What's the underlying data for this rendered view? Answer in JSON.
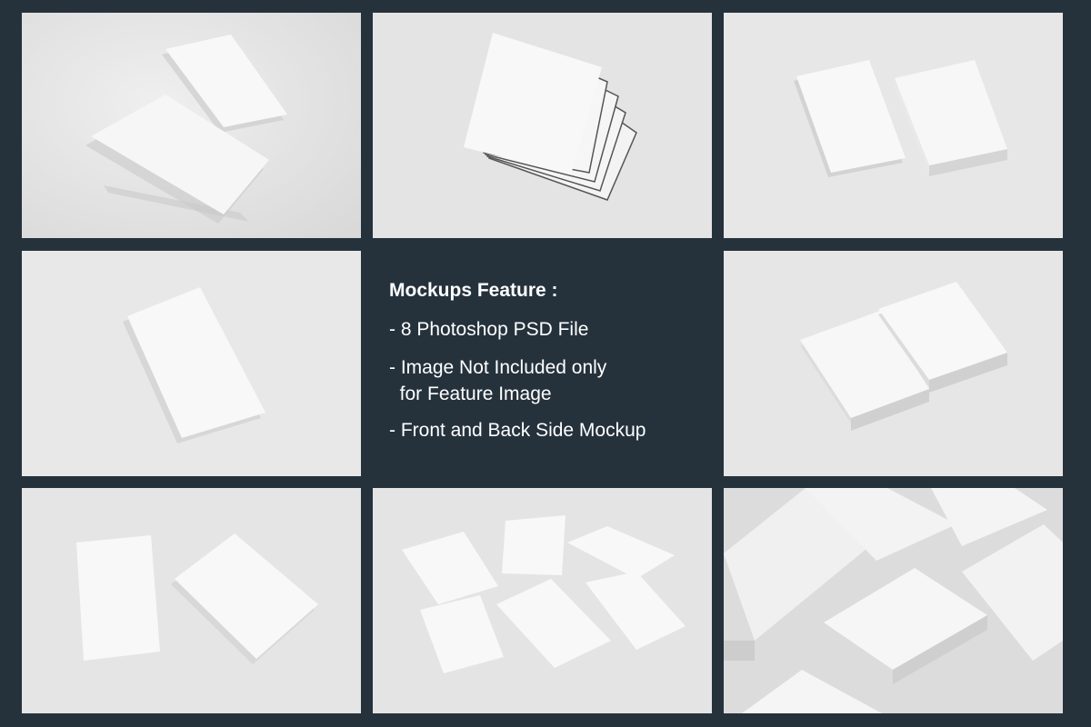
{
  "features": {
    "title": "Mockups Feature :",
    "items": [
      "- 8 Photoshop PSD File",
      "- Image Not Included only",
      "  for Feature Image",
      "- Front and Back Side Mockup"
    ]
  },
  "colors": {
    "background": "#25323c",
    "scene": "#e6e6e6",
    "card": "#f7f7f7",
    "shadow": "#c6c6c6",
    "text": "#ffffff"
  },
  "tiles": [
    {
      "name": "two-cards-tilted"
    },
    {
      "name": "fanned-card-stack"
    },
    {
      "name": "card-and-card-stack"
    },
    {
      "name": "single-card"
    },
    {
      "name": "two-card-stacks"
    },
    {
      "name": "two-cards-flat"
    },
    {
      "name": "scattered-cards"
    },
    {
      "name": "card-stacks-closeup"
    }
  ]
}
